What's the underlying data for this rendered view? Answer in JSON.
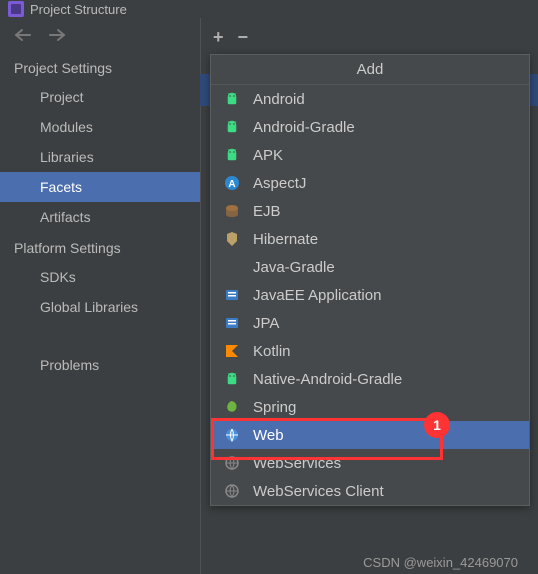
{
  "window": {
    "title": "Project Structure"
  },
  "toolbar": {
    "add": "+",
    "remove": "−"
  },
  "sidebar": {
    "section1": "Project Settings",
    "section2": "Platform Settings",
    "items1": [
      {
        "label": "Project"
      },
      {
        "label": "Modules"
      },
      {
        "label": "Libraries"
      },
      {
        "label": "Facets"
      },
      {
        "label": "Artifacts"
      }
    ],
    "items2": [
      {
        "label": "SDKs"
      },
      {
        "label": "Global Libraries"
      }
    ],
    "problems": "Problems"
  },
  "dropdown": {
    "title": "Add",
    "items": [
      {
        "label": "Android",
        "icon": "android-icon",
        "color": "#3ddc84"
      },
      {
        "label": "Android-Gradle",
        "icon": "android-icon",
        "color": "#3ddc84"
      },
      {
        "label": "APK",
        "icon": "android-icon",
        "color": "#3ddc84"
      },
      {
        "label": "AspectJ",
        "icon": "aspectj-icon",
        "color": "#2c88d0"
      },
      {
        "label": "EJB",
        "icon": "ejb-icon",
        "color": "#a07040"
      },
      {
        "label": "Hibernate",
        "icon": "hibernate-icon",
        "color": "#bca06a"
      },
      {
        "label": "Java-Gradle",
        "icon": "blank-icon",
        "color": "transparent"
      },
      {
        "label": "JavaEE Application",
        "icon": "javaee-icon",
        "color": "#3b7cc5"
      },
      {
        "label": "JPA",
        "icon": "jpa-icon",
        "color": "#3b7cc5"
      },
      {
        "label": "Kotlin",
        "icon": "kotlin-icon",
        "color": "#ff8a00"
      },
      {
        "label": "Native-Android-Gradle",
        "icon": "android-icon",
        "color": "#3ddc84"
      },
      {
        "label": "Spring",
        "icon": "spring-icon",
        "color": "#6db33f"
      },
      {
        "label": "Web",
        "icon": "web-icon",
        "color": "#4a90d9"
      },
      {
        "label": "WebServices",
        "icon": "webservices-icon",
        "color": "#888888"
      },
      {
        "label": "WebServices Client",
        "icon": "webservices-icon",
        "color": "#888888"
      }
    ]
  },
  "annotation": {
    "badge": "1"
  },
  "watermark": "CSDN @weixin_42469070"
}
